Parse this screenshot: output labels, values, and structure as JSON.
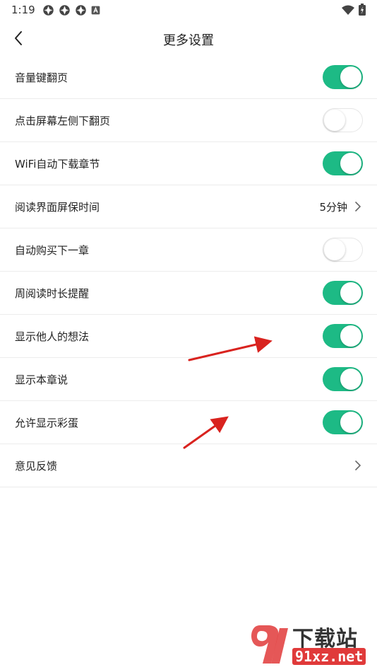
{
  "status_bar": {
    "time": "1:19",
    "left_icons": [
      "app-notification-icon",
      "app-notification-icon",
      "app-notification-icon",
      "a-letter-icon"
    ],
    "right_icons": [
      "wifi-icon",
      "battery-charging-icon"
    ]
  },
  "nav": {
    "title": "更多设置",
    "back_icon": "chevron-left-icon"
  },
  "settings": [
    {
      "label": "音量键翻页",
      "type": "toggle",
      "on": true
    },
    {
      "label": "点击屏幕左侧下翻页",
      "type": "toggle",
      "on": false
    },
    {
      "label": "WiFi自动下载章节",
      "type": "toggle",
      "on": true
    },
    {
      "label": "阅读界面屏保时间",
      "type": "value",
      "value": "5分钟"
    },
    {
      "label": "自动购买下一章",
      "type": "toggle",
      "on": false
    },
    {
      "label": "周阅读时长提醒",
      "type": "toggle",
      "on": true
    },
    {
      "label": "显示他人的想法",
      "type": "toggle",
      "on": true
    },
    {
      "label": "显示本章说",
      "type": "toggle",
      "on": true
    },
    {
      "label": "允许显示彩蛋",
      "type": "toggle",
      "on": true
    },
    {
      "label": "意见反馈",
      "type": "link"
    }
  ],
  "colors": {
    "toggle_on": "#1dba85",
    "annotation_arrow": "#d9231f",
    "watermark": "#e03a3a"
  },
  "watermark": {
    "line1": "下载站",
    "line2": "91xz.net"
  }
}
